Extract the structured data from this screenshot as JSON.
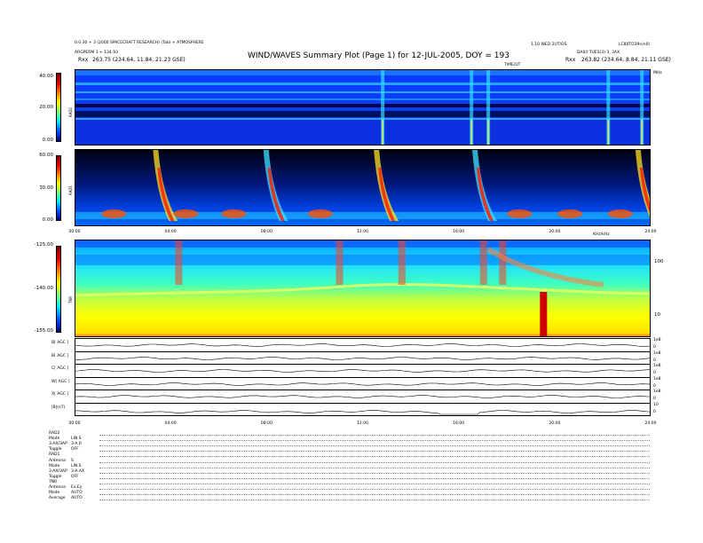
{
  "header": {
    "left_line1": "0.0.30 + 3 (2000 SPACECRAFT RESEARCH) (Tab) + ATMOSPHERE",
    "left_line2": "ARGPERM 3 + 134.93",
    "left_range_label": "Rxx",
    "left_range_value": "263.75 (234.64, 11.84, 21.23 GSE)",
    "title": "WIND/WAVES Summary Plot (Page 1) for 12-JUL-2005, DOY = 193",
    "right_top1": "1.10 WED 2UT/OS",
    "right_top2": "LC80TO39n/n0I",
    "right_line2": "DAILY TUES(3) 3, 3AX",
    "right_range_label": "Rxx",
    "right_range_value": "263.82 (234.64, 8.84, 21.11 GSE)",
    "time_label": "TIME/UT",
    "mhz_label": "MHz",
    "panel2_right_label": "KHz/kHz"
  },
  "rad2": {
    "label": "RAD2",
    "yticks": [
      "40.00",
      "20.00",
      "0.00"
    ]
  },
  "rad1": {
    "label": "RAD1",
    "yticks": [
      "60.00",
      "30.00",
      "0.00"
    ]
  },
  "tnr": {
    "label": "TNR",
    "yticks": [
      "-125.00",
      "-140.00",
      "-155.00"
    ],
    "right_ticks": [
      "100",
      "10"
    ]
  },
  "time_axis": {
    "ticks": [
      "00:00",
      "04:00",
      "08:00",
      "12:00",
      "16:00",
      "20:00",
      "24:00"
    ]
  },
  "bottom_axis": {
    "ticks": [
      "00:00",
      "04:00",
      "08:00",
      "12:00",
      "16:00",
      "20:00",
      "24:00"
    ]
  },
  "line_panels": [
    {
      "label": "B[ AGC ]",
      "right_top": "1e8",
      "right_bot": "0"
    },
    {
      "label": "B[ AGC ]",
      "right_top": "1e8",
      "right_bot": "0"
    },
    {
      "label": "C[ AGC ]",
      "right_top": "1e8",
      "right_bot": "0"
    },
    {
      "label": "W[ AGC ]",
      "right_top": "1e8",
      "right_bot": "0"
    },
    {
      "label": "X[ AGC ]",
      "right_top": "1e8",
      "right_bot": "0"
    },
    {
      "label": "|B|(nT)",
      "right_top": "10",
      "right_bot": "0"
    }
  ],
  "settings": [
    {
      "key": "RAD2",
      "val": ""
    },
    {
      "key": "Mode",
      "val": "LIN S"
    },
    {
      "key": "3-AX/3AP",
      "val": "3-A.P."
    },
    {
      "key": "Toggle",
      "val": "OFF"
    },
    {
      "key": "RAD1",
      "val": ""
    },
    {
      "key": "Antenna",
      "val": "S"
    },
    {
      "key": "Mode",
      "val": "LIN S"
    },
    {
      "key": "3-AX/3AP",
      "val": "3-A.AX"
    },
    {
      "key": "Toggle",
      "val": "OFF"
    },
    {
      "key": "TNR",
      "val": ""
    },
    {
      "key": "Antenna",
      "val": "Ex,Ey"
    },
    {
      "key": "Mode",
      "val": "AUTO"
    },
    {
      "key": "Average",
      "val": "AUTO"
    }
  ],
  "colors": {
    "spec_bg": "#0a3cff",
    "rad1_bg": "#0040e0",
    "tnr_bg": "#40ffb0"
  },
  "chart_data": {
    "type": "heatmap",
    "title": "WIND/WAVES Summary Plot (Page 1) for 12-JUL-2005, DOY = 193",
    "x_range_hours": [
      0,
      24
    ],
    "rad2_burst_hours": [
      12.8,
      16.5,
      17.2,
      22.2,
      23.6
    ],
    "rad1_burst_hours": [
      3.6,
      8.2,
      12.8,
      16.9,
      23.7
    ],
    "tnr_burst_hours": [
      4.3,
      11.0,
      13.6,
      17.0,
      17.8
    ]
  }
}
